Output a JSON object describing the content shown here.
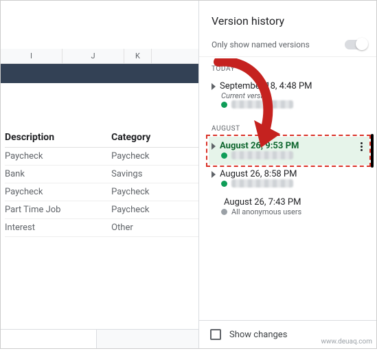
{
  "sheet": {
    "columns": [
      "I",
      "J",
      "K"
    ],
    "headers": {
      "description": "Description",
      "category": "Category"
    },
    "rows": [
      {
        "description": "Paycheck",
        "category": "Paycheck"
      },
      {
        "description": "Bank",
        "category": "Savings"
      },
      {
        "description": "Paycheck",
        "category": "Paycheck"
      },
      {
        "description": "Part Time Job",
        "category": "Paycheck"
      },
      {
        "description": "Interest",
        "category": "Other"
      }
    ]
  },
  "panel": {
    "title": "Version history",
    "toggleLabel": "Only show named versions",
    "groups": {
      "today": "TODAY",
      "august": "AUGUST"
    },
    "versions": {
      "v1": {
        "label": "September 18, 4:48 PM",
        "sub": "Current version"
      },
      "v2": {
        "label": "August 26, 9:53 PM"
      },
      "v3": {
        "label": "August 26, 8:58 PM"
      },
      "v4": {
        "label": "August 26, 7:43 PM",
        "sub": "All anonymous users"
      }
    },
    "footer": {
      "showChanges": "Show changes"
    }
  },
  "watermark": "www.deuaq.com"
}
